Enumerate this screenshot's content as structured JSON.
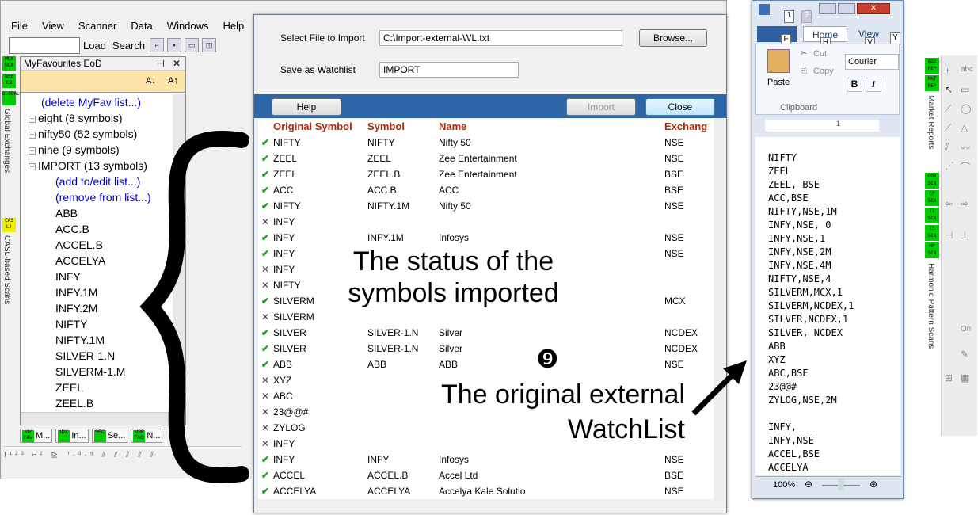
{
  "app": {
    "menu": [
      "File",
      "View",
      "Scanner",
      "Data",
      "Windows",
      "Help"
    ],
    "load_label": "Load",
    "search_label": "Search",
    "left_strip": {
      "badges": [
        "MCX NCX",
        "NSE CD",
        "GLOBAL"
      ],
      "label": "Global Exchanges",
      "casl_badge": "CAS L!",
      "casl_label": "CASL-based Scans"
    },
    "favourites": {
      "title": "MyFavourites EoD",
      "pin": "⊣",
      "close": "✕",
      "sort_az": "A↓",
      "sort_za": "A↑",
      "items": [
        {
          "text": "(delete MyFav list...)",
          "link": true,
          "indent": 1,
          "exp": ""
        },
        {
          "text": "eight (8 symbols)",
          "link": false,
          "indent": 0,
          "exp": "+"
        },
        {
          "text": "nifty50 (52 symbols)",
          "link": false,
          "indent": 0,
          "exp": "+"
        },
        {
          "text": "nine (9 symbols)",
          "link": false,
          "indent": 0,
          "exp": "+"
        },
        {
          "text": "IMPORT (13 symbols)",
          "link": false,
          "indent": 0,
          "exp": "−"
        },
        {
          "text": "(add to/edit list...)",
          "link": true,
          "indent": 2,
          "exp": ""
        },
        {
          "text": "(remove from list...)",
          "link": true,
          "indent": 2,
          "exp": ""
        },
        {
          "text": "ABB",
          "link": false,
          "indent": 2,
          "exp": ""
        },
        {
          "text": "ACC.B",
          "link": false,
          "indent": 2,
          "exp": ""
        },
        {
          "text": "ACCEL.B",
          "link": false,
          "indent": 2,
          "exp": ""
        },
        {
          "text": "ACCELYA",
          "link": false,
          "indent": 2,
          "exp": ""
        },
        {
          "text": "INFY",
          "link": false,
          "indent": 2,
          "exp": ""
        },
        {
          "text": "INFY.1M",
          "link": false,
          "indent": 2,
          "exp": ""
        },
        {
          "text": "INFY.2M",
          "link": false,
          "indent": 2,
          "exp": ""
        },
        {
          "text": "NIFTY",
          "link": false,
          "indent": 2,
          "exp": ""
        },
        {
          "text": "NIFTY.1M",
          "link": false,
          "indent": 2,
          "exp": ""
        },
        {
          "text": "SILVER-1.N",
          "link": false,
          "indent": 2,
          "exp": ""
        },
        {
          "text": "SILVERM-1.M",
          "link": false,
          "indent": 2,
          "exp": ""
        },
        {
          "text": "ZEEL",
          "link": false,
          "indent": 2,
          "exp": ""
        },
        {
          "text": "ZEEL.B",
          "link": false,
          "indent": 2,
          "exp": ""
        }
      ]
    },
    "bottom_tabs": [
      {
        "badge": "MY FAV",
        "label": "M..."
      },
      {
        "badge": "IDX",
        "label": "In..."
      },
      {
        "badge": "SEC",
        "label": "Se..."
      },
      {
        "badge": "NSE F&O",
        "label": "N..."
      }
    ],
    "bottom_toolbar": "I¹²³ ⌐² ⊵ ⁰·³·⁵ ⫽ ⫽ ⫽ ⫽ ⫽"
  },
  "dialog": {
    "select_label": "Select File to Import",
    "file_value": "C:\\Import-external-WL.txt",
    "browse": "Browse...",
    "save_label": "Save as Watchlist",
    "watchlist_value": "IMPORT",
    "help": "Help",
    "import": "Import",
    "close": "Close",
    "columns": [
      "Original Symbol",
      "Symbol",
      "Name",
      "Exchang"
    ],
    "rows": [
      {
        "ok": true,
        "orig": "NIFTY",
        "sym": "NIFTY",
        "name": "Nifty 50",
        "ex": "NSE"
      },
      {
        "ok": true,
        "orig": "ZEEL",
        "sym": "ZEEL",
        "name": "Zee Entertainment",
        "ex": "NSE"
      },
      {
        "ok": true,
        "orig": "ZEEL",
        "sym": "ZEEL.B",
        "name": "Zee Entertainment",
        "ex": "BSE"
      },
      {
        "ok": true,
        "orig": "ACC",
        "sym": "ACC.B",
        "name": "ACC",
        "ex": "BSE"
      },
      {
        "ok": true,
        "orig": "NIFTY",
        "sym": "NIFTY.1M",
        "name": "Nifty 50",
        "ex": "NSE"
      },
      {
        "ok": false,
        "orig": "INFY",
        "sym": "",
        "name": "",
        "ex": ""
      },
      {
        "ok": true,
        "orig": "INFY",
        "sym": "INFY.1M",
        "name": "Infosys",
        "ex": "NSE"
      },
      {
        "ok": true,
        "orig": "INFY",
        "sym": "",
        "name": "",
        "ex": "NSE"
      },
      {
        "ok": false,
        "orig": "INFY",
        "sym": "",
        "name": "",
        "ex": ""
      },
      {
        "ok": false,
        "orig": "NIFTY",
        "sym": "",
        "name": "",
        "ex": ""
      },
      {
        "ok": true,
        "orig": "SILVERM",
        "sym": "",
        "name": "",
        "ex": "MCX"
      },
      {
        "ok": false,
        "orig": "SILVERM",
        "sym": "",
        "name": "",
        "ex": ""
      },
      {
        "ok": true,
        "orig": "SILVER",
        "sym": "SILVER-1.N",
        "name": "Silver",
        "ex": "NCDEX"
      },
      {
        "ok": true,
        "orig": "SILVER",
        "sym": "SILVER-1.N",
        "name": "Silver",
        "ex": "NCDEX"
      },
      {
        "ok": true,
        "orig": "ABB",
        "sym": "ABB",
        "name": "ABB",
        "ex": "NSE"
      },
      {
        "ok": false,
        "orig": "XYZ",
        "sym": "",
        "name": "",
        "ex": ""
      },
      {
        "ok": false,
        "orig": "ABC",
        "sym": "",
        "name": "",
        "ex": ""
      },
      {
        "ok": false,
        "orig": "23@@#",
        "sym": "",
        "name": "",
        "ex": ""
      },
      {
        "ok": false,
        "orig": "ZYLOG",
        "sym": "",
        "name": "",
        "ex": ""
      },
      {
        "ok": false,
        "orig": "INFY",
        "sym": "",
        "name": "",
        "ex": ""
      },
      {
        "ok": true,
        "orig": "INFY",
        "sym": "INFY",
        "name": "Infosys",
        "ex": "NSE"
      },
      {
        "ok": true,
        "orig": "ACCEL",
        "sym": "ACCEL.B",
        "name": "Accel Ltd",
        "ex": "BSE"
      },
      {
        "ok": true,
        "orig": "ACCELYA",
        "sym": "ACCELYA",
        "name": "Accelya Kale Solutio",
        "ex": "NSE"
      }
    ]
  },
  "annotations": {
    "status": "The status of the symbols imported",
    "marker": "❾",
    "original": "The original external WatchList"
  },
  "notepad": {
    "qat_1": "1",
    "qat_2": "2",
    "tab_file": "F",
    "tab_home": "Home",
    "tab_home_key": "H",
    "tab_view": "View",
    "tab_view_key": "V",
    "tab_y": "Y",
    "paste": "Paste",
    "cut": "Cut",
    "copy": "Copy",
    "clipboard": "Clipboard",
    "font": "Courier",
    "bold": "B",
    "italic": "I",
    "ruler_mark": "1",
    "lines": [
      "NIFTY",
      "ZEEL",
      "ZEEL, BSE",
      "ACC,BSE",
      "NIFTY,NSE,1M",
      "INFY,NSE, 0",
      "INFY,NSE,1",
      "INFY,NSE,2M",
      "INFY,NSE,4M",
      "NIFTY,NSE,4",
      "SILVERM,MCX,1",
      "SILVERM,NCDEX,1",
      "SILVER,NCDEX,1",
      "SILVER, NCDEX",
      "ABB",
      "XYZ",
      "ABC,BSE",
      "23@@#",
      "ZYLOG,NSE,2M",
      "",
      "INFY,",
      "INFY,NSE",
      "ACCEL,BSE",
      "ACCELYA"
    ],
    "zoom": "100%"
  },
  "right_panel": {
    "badges_top": [
      "ADV REP",
      "MKT REP"
    ],
    "label_top": "Market Reports",
    "badges_bottom": [
      "CON SCN",
      "CP SCN",
      "TI SCN",
      "TS SCN",
      "HP SCN"
    ],
    "label_bottom": "Harmonic Pattern Scans",
    "abc": "abc",
    "on": "On"
  }
}
